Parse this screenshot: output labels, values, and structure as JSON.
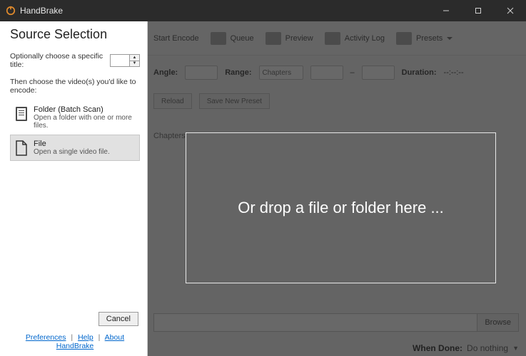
{
  "titlebar": {
    "app_name": "HandBrake"
  },
  "toolbar": {
    "start_encode": "Start Encode",
    "queue": "Queue",
    "preview": "Preview",
    "activity_log": "Activity Log",
    "presets": "Presets"
  },
  "header_row": {
    "angle": "Angle:",
    "range": "Range:",
    "range_value": "Chapters",
    "dash": "–",
    "duration": "Duration:",
    "duration_value": "--:--:--"
  },
  "buttons_row": {
    "reload": "Reload",
    "save_new": "Save New Preset"
  },
  "tabs": {
    "chapters": "Chapters"
  },
  "browse": {
    "label": "Browse"
  },
  "when_done": {
    "label": "When Done:",
    "value": "Do nothing"
  },
  "dropzone": {
    "text": "Or drop a file or folder here ..."
  },
  "panel": {
    "title": "Source Selection",
    "opt_label": "Optionally choose a specific title:",
    "title_value": "",
    "choose_label": "Then choose the video(s) you'd like to encode:",
    "folder": {
      "title": "Folder (Batch Scan)",
      "desc": "Open a folder with one or more files."
    },
    "file": {
      "title": "File",
      "desc": "Open a single video file."
    },
    "cancel": "Cancel",
    "links": {
      "preferences": "Preferences",
      "help": "Help",
      "about": "About HandBrake"
    }
  }
}
